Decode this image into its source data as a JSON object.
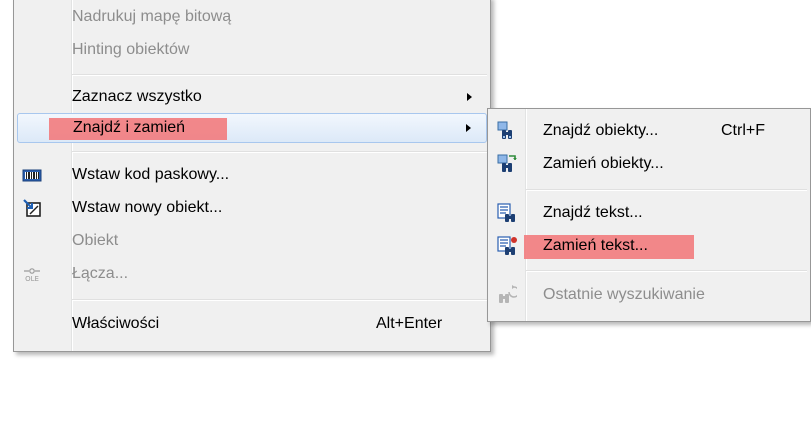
{
  "main_menu": {
    "items": [
      {
        "label": "Nadrukuj mapę bitową",
        "disabled": true
      },
      {
        "label": "Hinting obiektów",
        "disabled": true
      },
      {
        "label": "Zaznacz wszystko",
        "disabled": false,
        "submenu": true
      },
      {
        "label": "Znajdź i zamień",
        "disabled": false,
        "submenu": true,
        "highlighted": true
      },
      {
        "label": "Wstaw kod paskowy...",
        "disabled": false,
        "icon": "barcode-icon"
      },
      {
        "label": "Wstaw nowy obiekt...",
        "disabled": false,
        "icon": "insert-object-icon"
      },
      {
        "label": "Obiekt",
        "disabled": true
      },
      {
        "label": "Łącza...",
        "disabled": true,
        "icon": "ole-icon"
      },
      {
        "label": "Właściwości",
        "shortcut": "Alt+Enter",
        "disabled": false
      }
    ],
    "ole_icon_text": "OLE"
  },
  "sub_menu": {
    "items": [
      {
        "label": "Znajdź obiekty...",
        "shortcut": "Ctrl+F",
        "icon": "find-objects-icon"
      },
      {
        "label": "Zamień obiekty...",
        "icon": "replace-objects-icon"
      },
      {
        "label": "Znajdź tekst...",
        "icon": "find-text-icon"
      },
      {
        "label": "Zamień tekst...",
        "icon": "replace-text-icon",
        "highlighted": true
      },
      {
        "label": "Ostatnie wyszukiwanie",
        "disabled": true,
        "icon": "recent-search-icon"
      }
    ]
  },
  "colors": {
    "menu_bg": "#f0f0f0",
    "menu_border": "#979797",
    "highlight": "#f27b7d",
    "disabled_text": "#8d8d8d",
    "hover_border": "#a8c7ee"
  }
}
